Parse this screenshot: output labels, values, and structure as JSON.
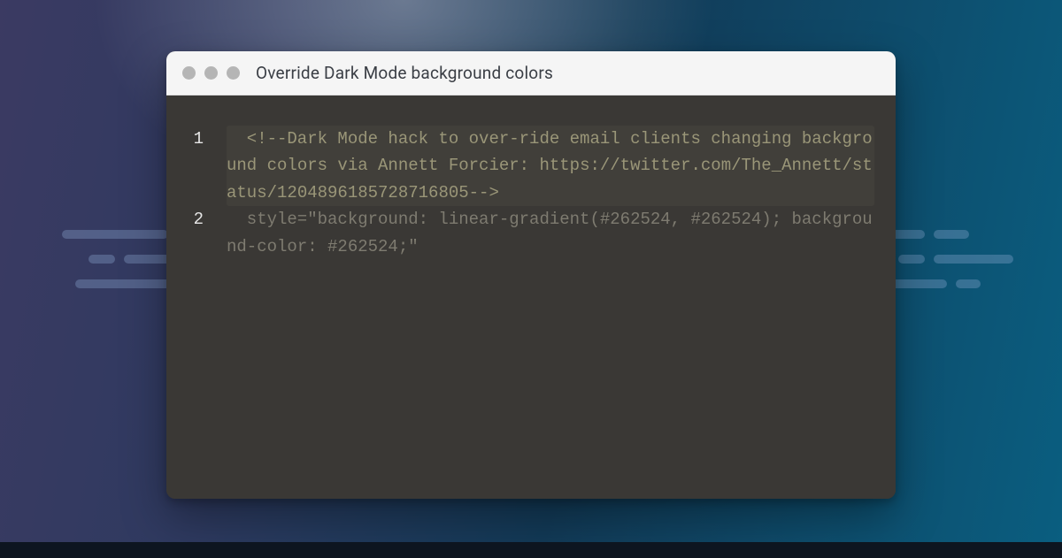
{
  "window": {
    "title": "Override Dark Mode background colors"
  },
  "code": {
    "lines": [
      {
        "n": "1",
        "kind": "comment",
        "text": "<!--Dark Mode hack to over-ride email clients changing background colors via Annett Forcier: https://twitter.com/The_Annett/status/1204896185728716805-->"
      },
      {
        "n": "2",
        "kind": "code",
        "text": "style=\"background: linear-gradient(#262524, #262524); background-color: #262524;\""
      }
    ]
  }
}
